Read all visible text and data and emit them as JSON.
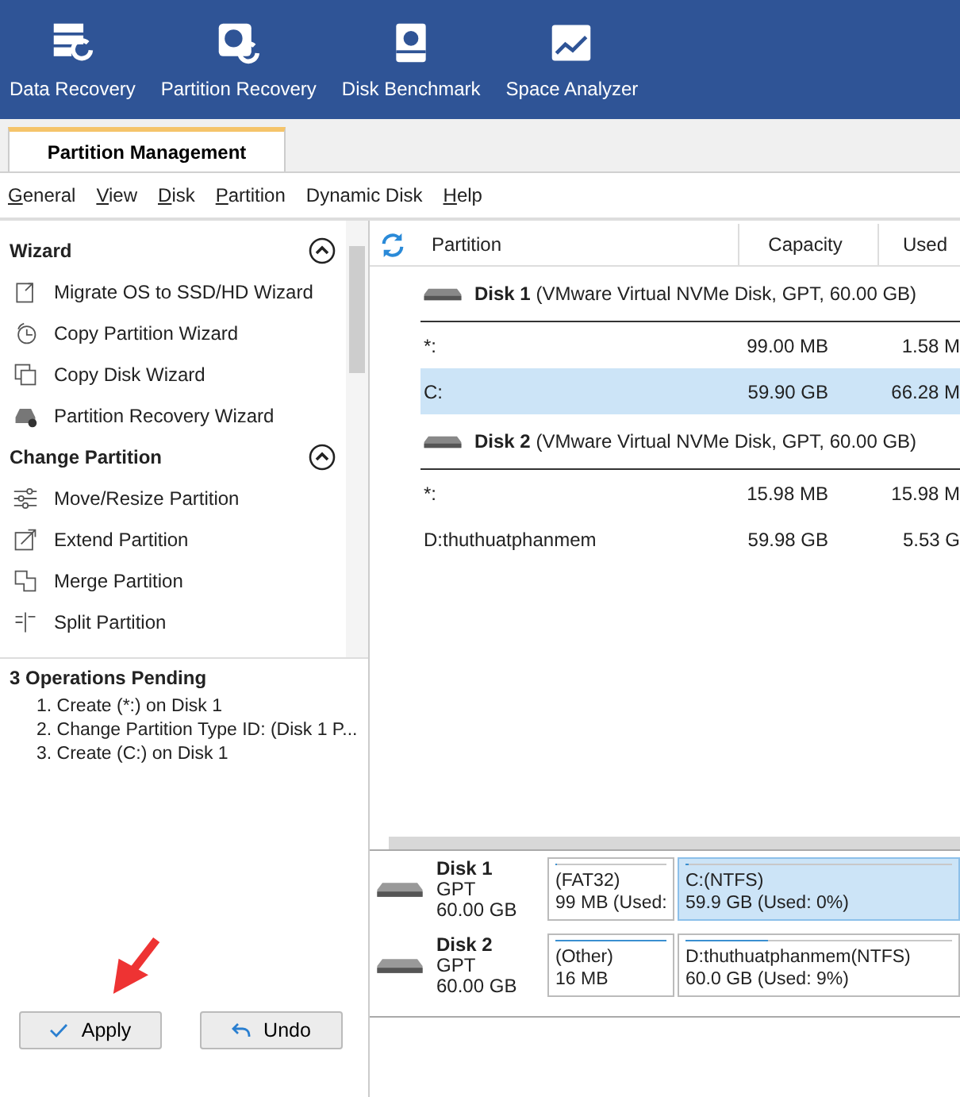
{
  "toolbar": [
    {
      "label": "Data Recovery",
      "kind": "data"
    },
    {
      "label": "Partition Recovery",
      "kind": "partition"
    },
    {
      "label": "Disk Benchmark",
      "kind": "benchmark"
    },
    {
      "label": "Space Analyzer",
      "kind": "analyzer"
    }
  ],
  "tabs": [
    {
      "label": "Partition Management",
      "selected": true
    }
  ],
  "menu": [
    {
      "label": "General",
      "underline_first": true
    },
    {
      "label": "View",
      "underline_first": true
    },
    {
      "label": "Disk",
      "underline_first": true
    },
    {
      "label": "Partition",
      "underline_first": true
    },
    {
      "label": "Dynamic Disk",
      "underline_first": false
    },
    {
      "label": "Help",
      "underline_first": true
    }
  ],
  "sidebar": {
    "sections": [
      {
        "title": "Wizard",
        "expanded": true,
        "items": [
          {
            "label": "Migrate OS to SSD/HD Wizard",
            "kind": "migrate"
          },
          {
            "label": "Copy Partition Wizard",
            "kind": "copypart"
          },
          {
            "label": "Copy Disk Wizard",
            "kind": "copydisk"
          },
          {
            "label": "Partition Recovery Wizard",
            "kind": "recover"
          }
        ]
      },
      {
        "title": "Change Partition",
        "expanded": true,
        "items": [
          {
            "label": "Move/Resize Partition",
            "kind": "resize"
          },
          {
            "label": "Extend Partition",
            "kind": "extend"
          },
          {
            "label": "Merge Partition",
            "kind": "merge"
          },
          {
            "label": "Split Partition",
            "kind": "split"
          }
        ]
      }
    ],
    "pending": {
      "title": "3 Operations Pending",
      "items": [
        "1. Create (*:) on Disk 1",
        "2. Change Partition Type ID: (Disk 1 P...",
        "3. Create (C:) on Disk 1"
      ]
    },
    "buttons": [
      {
        "label": "Apply",
        "kind": "check"
      },
      {
        "label": "Undo",
        "kind": "undo"
      }
    ]
  },
  "table": {
    "columns": [
      "Partition",
      "Capacity",
      "Used"
    ],
    "disks": [
      {
        "name": "Disk 1",
        "detail": "(VMware Virtual NVMe Disk, GPT, 60.00 GB)",
        "rows": [
          {
            "partition": "*:",
            "capacity": "99.00 MB",
            "used": "1.58 M",
            "selected": false
          },
          {
            "partition": "C:",
            "capacity": "59.90 GB",
            "used": "66.28 M",
            "selected": true
          }
        ]
      },
      {
        "name": "Disk 2",
        "detail": "(VMware Virtual NVMe Disk, GPT, 60.00 GB)",
        "rows": [
          {
            "partition": "*:",
            "capacity": "15.98 MB",
            "used": "15.98 M",
            "selected": false
          },
          {
            "partition": "D:thuthuatphanmem",
            "capacity": "59.98 GB",
            "used": "5.53 G",
            "selected": false
          }
        ]
      }
    ]
  },
  "disk_map": [
    {
      "name": "Disk 1",
      "type": "GPT",
      "size": "60.00 GB",
      "partitions": [
        {
          "label": "(FAT32)",
          "detail": "99 MB (Used:",
          "level": 0.02,
          "selected": false
        },
        {
          "label": "C:(NTFS)",
          "detail": "59.9 GB (Used: 0%)",
          "level": 0.01,
          "selected": true
        }
      ]
    },
    {
      "name": "Disk 2",
      "type": "GPT",
      "size": "60.00 GB",
      "partitions": [
        {
          "label": "(Other)",
          "detail": "16 MB",
          "level": 1,
          "selected": false
        },
        {
          "label": "D:thuthuatphanmem(NTFS)",
          "detail": "60.0 GB (Used: 9%)",
          "level": 0.31,
          "selected": false
        }
      ]
    }
  ]
}
